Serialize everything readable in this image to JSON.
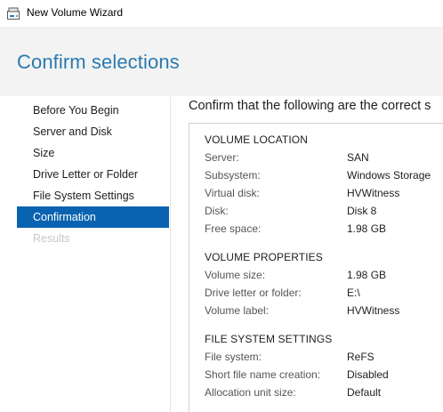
{
  "window": {
    "title": "New Volume Wizard",
    "icon": "disk-icon"
  },
  "header": {
    "page_title": "Confirm selections"
  },
  "nav": {
    "items": [
      {
        "label": "Before You Begin",
        "state": "normal"
      },
      {
        "label": "Server and Disk",
        "state": "normal"
      },
      {
        "label": "Size",
        "state": "normal"
      },
      {
        "label": "Drive Letter or Folder",
        "state": "normal"
      },
      {
        "label": "File System Settings",
        "state": "normal"
      },
      {
        "label": "Confirmation",
        "state": "active"
      },
      {
        "label": "Results",
        "state": "disabled"
      }
    ]
  },
  "main": {
    "instruction": "Confirm that the following are the correct s",
    "sections": [
      {
        "heading": "VOLUME LOCATION",
        "rows": [
          {
            "label": "Server:",
            "value": "SAN"
          },
          {
            "label": "Subsystem:",
            "value": "Windows Storage"
          },
          {
            "label": "Virtual disk:",
            "value": "HVWitness"
          },
          {
            "label": "Disk:",
            "value": "Disk 8"
          },
          {
            "label": "Free space:",
            "value": "1.98 GB"
          }
        ]
      },
      {
        "heading": "VOLUME PROPERTIES",
        "rows": [
          {
            "label": "Volume size:",
            "value": "1.98 GB"
          },
          {
            "label": "Drive letter or folder:",
            "value": "E:\\"
          },
          {
            "label": "Volume label:",
            "value": "HVWitness"
          }
        ]
      },
      {
        "heading": "FILE SYSTEM SETTINGS",
        "rows": [
          {
            "label": "File system:",
            "value": "ReFS"
          },
          {
            "label": "Short file name creation:",
            "value": "Disabled"
          },
          {
            "label": "Allocation unit size:",
            "value": "Default"
          }
        ]
      }
    ]
  },
  "colors": {
    "accent": "#0a63b0",
    "title_blue": "#2a7ab0",
    "header_bg": "#f3f3f3"
  }
}
